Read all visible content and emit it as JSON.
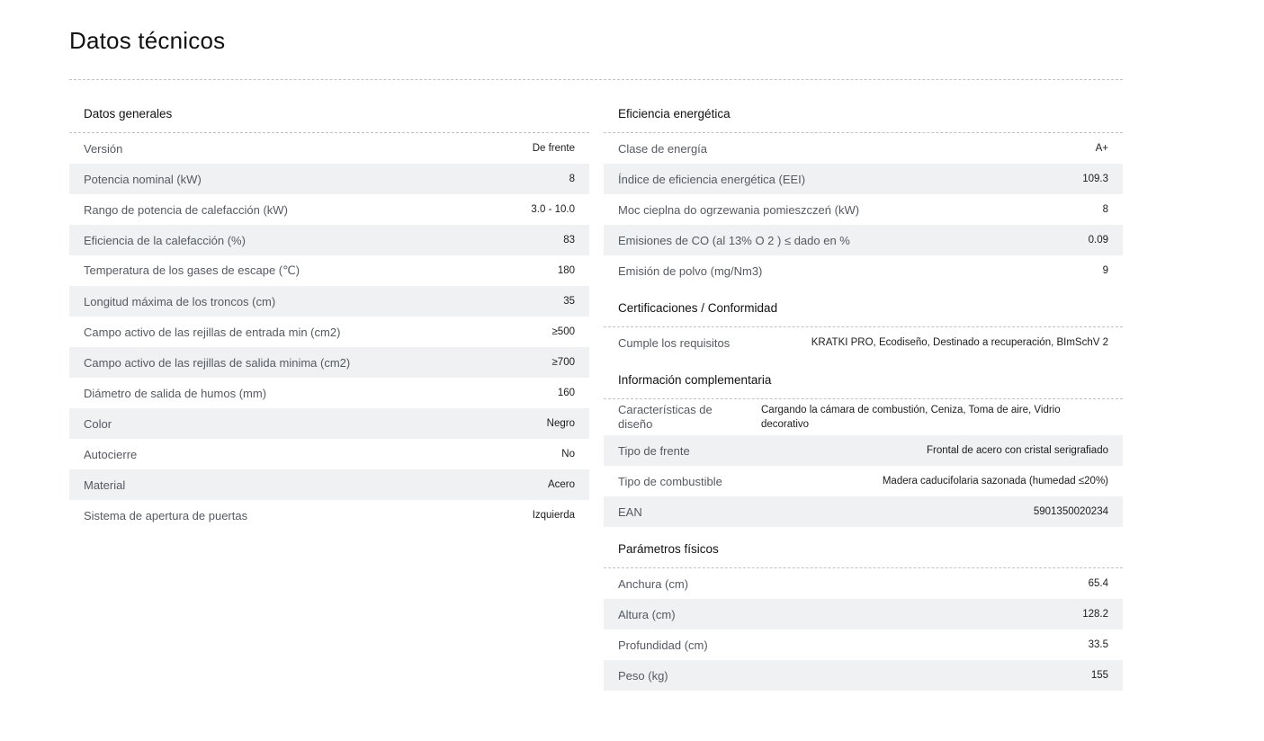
{
  "page": {
    "title": "Datos técnicos"
  },
  "general": {
    "title": "Datos generales",
    "rows": [
      {
        "label": "Versión",
        "value": "De frente"
      },
      {
        "label": "Potencia nominal (kW)",
        "value": "8"
      },
      {
        "label": "Rango de potencia de calefacción (kW)",
        "value": "3.0 - 10.0"
      },
      {
        "label": "Eficiencia de la calefacción (%)",
        "value": "83"
      },
      {
        "label": "Temperatura de los gases de escape (℃)",
        "value": "180"
      },
      {
        "label": "Longitud máxima de los troncos (cm)",
        "value": "35"
      },
      {
        "label": "Campo activo de las rejillas de entrada min (cm2)",
        "value": "≥500"
      },
      {
        "label": "Campo activo de las rejillas de salida minima (cm2)",
        "value": "≥700"
      },
      {
        "label": "Diámetro de salida de humos (mm)",
        "value": "160"
      },
      {
        "label": "Color",
        "value": "Negro"
      },
      {
        "label": "Autocierre",
        "value": "No"
      },
      {
        "label": "Material",
        "value": "Acero"
      },
      {
        "label": "Sistema de apertura de puertas",
        "value": "Izquierda"
      }
    ]
  },
  "efficiency": {
    "title": "Eficiencia energética",
    "rows": [
      {
        "label": "Clase de energía",
        "value": "A+"
      },
      {
        "label": "Índice de eficiencia energética (EEI)",
        "value": "109.3"
      },
      {
        "label": "Moc cieplna do ogrzewania pomieszczeń (kW)",
        "value": "8"
      },
      {
        "label": "Emisiones de CO (al 13% O 2 ) ≤ dado en %",
        "value": "0.09"
      },
      {
        "label": "Emisión de polvo (mg/Nm3)",
        "value": "9"
      }
    ]
  },
  "certifications": {
    "title": "Certificaciones / Conformidad",
    "rows": [
      {
        "label": "Cumple los requisitos",
        "value": "KRATKI PRO, Ecodiseño, Destinado a recuperación, BImSchV 2"
      }
    ]
  },
  "complementary": {
    "title": "Información complementaria",
    "rows": [
      {
        "label": "Características de diseño",
        "value": "Cargando la cámara de combustión, Ceniza, Toma de aire, Vidrio decorativo"
      },
      {
        "label": "Tipo de frente",
        "value": "Frontal de acero con cristal serigrafiado"
      },
      {
        "label": "Tipo de combustible",
        "value": "Madera caducifolaria sazonada (humedad ≤20%)"
      },
      {
        "label": "EAN",
        "value": "5901350020234"
      }
    ]
  },
  "physical": {
    "title": "Parámetros físicos",
    "rows": [
      {
        "label": "Anchura (cm)",
        "value": "65.4"
      },
      {
        "label": "Altura (cm)",
        "value": "128.2"
      },
      {
        "label": "Profundidad (cm)",
        "value": "33.5"
      },
      {
        "label": "Peso (kg)",
        "value": "155"
      }
    ]
  }
}
